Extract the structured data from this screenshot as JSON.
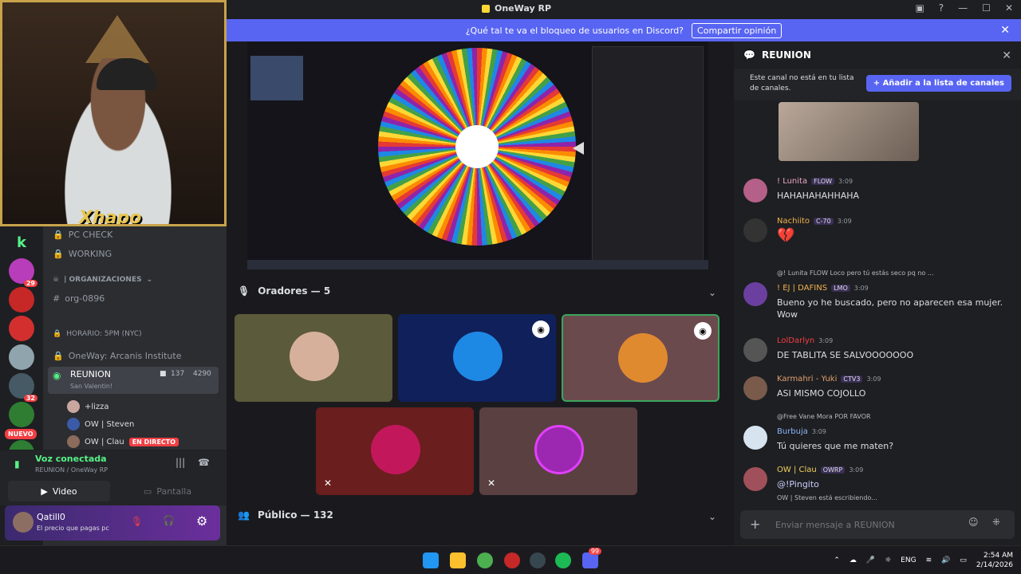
{
  "window": {
    "title": "OneWay RP"
  },
  "notice": {
    "text": "¿Qué tal te va el bloqueo de usuarios en Discord?",
    "button": "Compartir opinión"
  },
  "webcam": {
    "overlay_text": "Xhapo"
  },
  "servers": [
    {
      "name": "server-1",
      "color": "#57f287",
      "badge": ""
    },
    {
      "name": "server-2",
      "color": "#b83dba",
      "badge": "29"
    },
    {
      "name": "server-3",
      "color": "#c62828",
      "badge": ""
    },
    {
      "name": "server-4",
      "color": "#d32f2f",
      "badge": ""
    },
    {
      "name": "server-5",
      "color": "#90a4ae",
      "badge": ""
    },
    {
      "name": "server-6",
      "color": "#455a64",
      "badge": "32"
    },
    {
      "name": "server-7",
      "color": "#2e7d32",
      "badge": ""
    },
    {
      "name": "server-8",
      "color": "#2e7d32",
      "badge": ""
    }
  ],
  "nuevo_label": "NUEVO",
  "channels": {
    "pc_check": "PC CHECK",
    "working": "WORKING",
    "category": "| ORGANIZACIONES",
    "org": "org-0896",
    "horario": "HORARIO: 5PM (NYC)",
    "institute": "OneWay: Arcanis Institute",
    "active_voice": {
      "name": "REUNION",
      "subtitle": "San Valentin!",
      "count1": "137",
      "count2": "4290"
    },
    "voice_users": [
      {
        "name": "+lizza",
        "color": "#c9a7a0"
      },
      {
        "name": "OW | Steven",
        "color": "#3b5aa8"
      },
      {
        "name": "OW | Clau",
        "color": "#8b6b5b",
        "live": "EN DIRECTO"
      }
    ]
  },
  "voice_panel": {
    "status": "Voz conectada",
    "location": "REUNION / OneWay RP",
    "video_btn": "Video",
    "screen_btn": "Pantalla"
  },
  "user_panel": {
    "name": "Qatill0",
    "status": "El precio que pagas pc"
  },
  "main": {
    "speakers_label": "Oradores — 5",
    "public_label": "Público — 132",
    "tiles": [
      {
        "name": "tile-woman",
        "bg": "#5b5a3a",
        "avatar": "#d6b09a"
      },
      {
        "name": "tile-steven",
        "bg": "#10205a",
        "avatar": "#1e88e5"
      },
      {
        "name": "tile-clau",
        "bg": "#6b4a4e",
        "avatar": "#e08a30"
      },
      {
        "name": "tile-juany",
        "bg": "#6a1e1e",
        "avatar": "#c2185b"
      },
      {
        "name": "tile-purple",
        "bg": "#5a4040",
        "avatar": "#9c27b0"
      }
    ]
  },
  "chat": {
    "title": "REUNION",
    "note": "Este canal no está en tu lista de canales.",
    "add_button": "+ Añadir a la lista de canales",
    "messages": [
      {
        "name": "! Lunita",
        "tag": "FLOW",
        "time": "3:09",
        "text": "HAHAHAHAHHAHA",
        "color": "#eaa7c4",
        "av": "#b56088"
      },
      {
        "name": "Nachiito",
        "tag": "C-70",
        "time": "3:09",
        "text": "",
        "color": "#f0b24c",
        "av": "#333"
      },
      {
        "name": "! EJ | DAFINS",
        "tag": "LMO",
        "time": "3:09",
        "text": "Bueno yo he buscado, pero no aparecen esa mujer. Wow",
        "color": "#f0b24c",
        "av": "#6b3fa0",
        "reply": "@! Lunita FLOW Loco pero tú estás seco pq no ..."
      },
      {
        "name": "LolDarlyn",
        "tag": "",
        "time": "3:09",
        "text": "DE TABLITA SE SALVOOOOOOO",
        "color": "#f23f43",
        "av": "#555"
      },
      {
        "name": "Karmahri - Yuki",
        "tag": "CTV3",
        "time": "3:09",
        "text": "ASI MISMO COJOLLO",
        "color": "#e0a070",
        "av": "#7a5a4a"
      },
      {
        "name": "Burbuja",
        "tag": "",
        "time": "3:09",
        "text": "Tú quieres que me maten?",
        "color": "#89b4f8",
        "av": "#d7e4f0",
        "reply": "@Free Vane Mora POR FAVOR"
      },
      {
        "name": "OW | Clau",
        "tag": "OWRP",
        "time": "3:09",
        "text": "@!Pingito",
        "color": "#f0d060",
        "av": "#a0505a"
      }
    ],
    "typing": "OW | Steven está escribiendo...",
    "placeholder": "Enviar mensaje a REUNION"
  },
  "taskbar": {
    "lang": "ENG",
    "time": "2:54 AM",
    "date": "2/14/2026",
    "discord_badge": "99"
  }
}
